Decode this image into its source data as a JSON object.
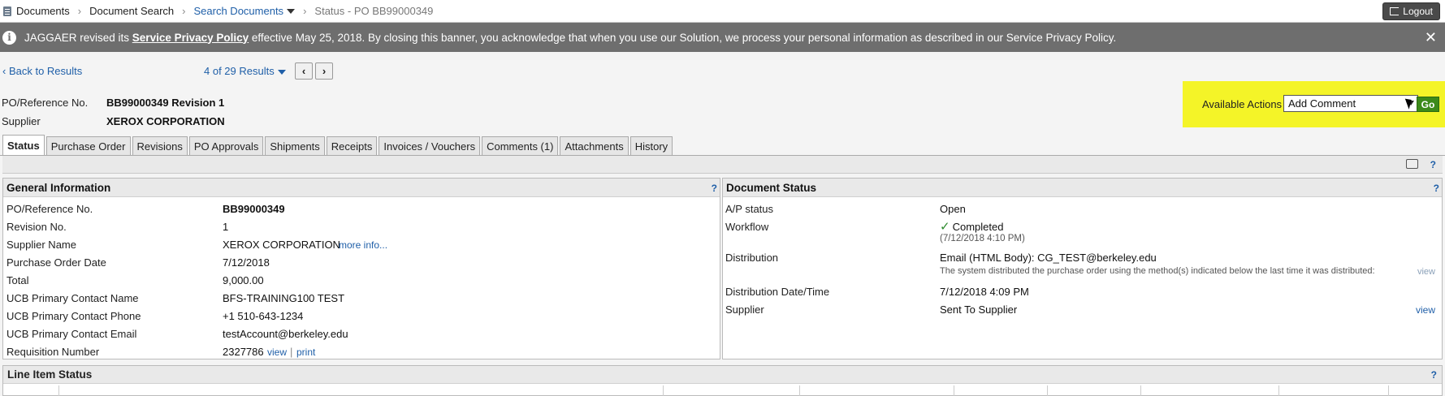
{
  "breadcrumb": {
    "items": [
      "Documents",
      "Document Search",
      "Search Documents",
      "Status - PO BB99000349"
    ]
  },
  "logout_label": "Logout",
  "banner": {
    "prefix": "JAGGAER revised its ",
    "link": "Service Privacy Policy",
    "suffix": " effective May 25, 2018. By closing this banner, you acknowledge that when you use our Solution, we process your personal information as described in our Service Privacy Policy.",
    "close": "✕"
  },
  "nav": {
    "back": "Back to Results",
    "results": "4 of 29 Results",
    "prev": "‹",
    "next": "›"
  },
  "header": {
    "po_label": "PO/Reference No.",
    "po_value": "BB99000349 Revision 1",
    "supplier_label": "Supplier",
    "supplier_value": "XEROX CORPORATION"
  },
  "actions": {
    "label": "Available Actions",
    "selected": "Add Comment",
    "go": "Go"
  },
  "tabs": [
    "Status",
    "Purchase Order",
    "Revisions",
    "PO Approvals",
    "Shipments",
    "Receipts",
    "Invoices / Vouchers",
    "Comments (1)",
    "Attachments",
    "History"
  ],
  "help": "?",
  "general": {
    "title": "General Information",
    "rows": [
      {
        "label": "PO/Reference No.",
        "value": "BB99000349"
      },
      {
        "label": "Revision No.",
        "value": "1"
      },
      {
        "label": "Supplier Name",
        "value": "XEROX CORPORATION",
        "link": "more info..."
      },
      {
        "label": "Purchase Order Date",
        "value": "7/12/2018"
      },
      {
        "label": "Total",
        "value": "9,000.00"
      },
      {
        "label": "UCB Primary Contact Name",
        "value": "BFS-TRAINING100 TEST"
      },
      {
        "label": "UCB Primary Contact Phone",
        "value": "+1 510-643-1234"
      },
      {
        "label": "UCB Primary Contact Email",
        "value": "testAccount@berkeley.edu"
      },
      {
        "label": "Requisition Number",
        "value": "2327786",
        "link": "view",
        "divider": "|",
        "link2": "print"
      }
    ]
  },
  "docstatus": {
    "title": "Document Status",
    "ap_label": "A/P status",
    "ap_value": "Open",
    "workflow_label": "Workflow",
    "workflow_value": "Completed",
    "workflow_date": "(7/12/2018 4:10 PM)",
    "dist_label": "Distribution",
    "dist_value": "Email (HTML Body): CG_TEST@berkeley.edu",
    "dist_note": "The system distributed the purchase order using the method(s) indicated below the last time it was distributed:",
    "dist_view": "view",
    "distdt_label": "Distribution Date/Time",
    "distdt_value": "7/12/2018 4:09 PM",
    "supplier_label": "Supplier",
    "supplier_value": "Sent To Supplier",
    "supplier_view": "view"
  },
  "lineitem": {
    "title": "Line Item Status"
  }
}
